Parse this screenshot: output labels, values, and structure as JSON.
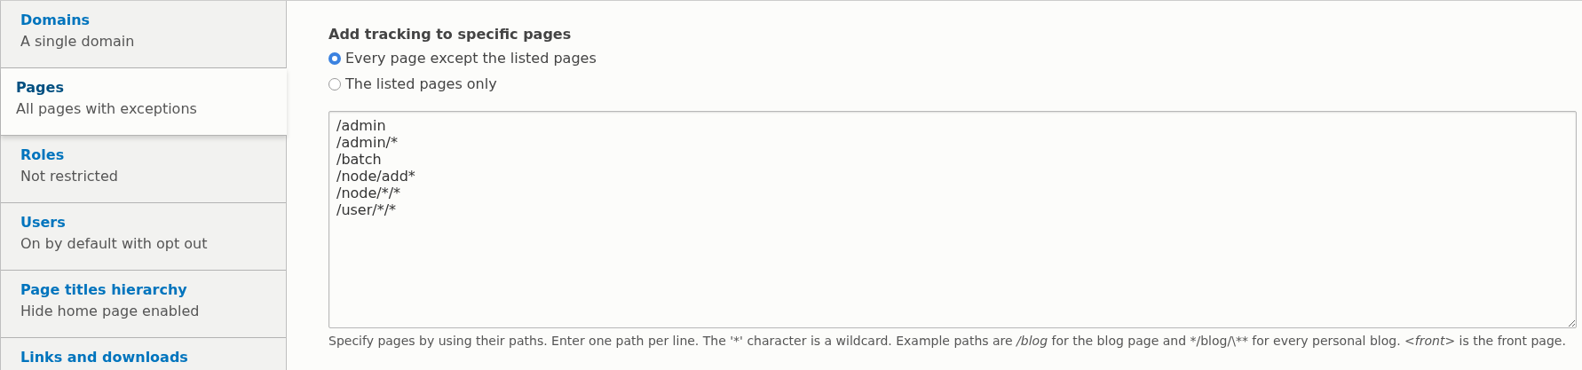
{
  "sidebar": {
    "items": [
      {
        "title": "Domains",
        "summary": "A single domain",
        "selected": false
      },
      {
        "title": "Pages",
        "summary": "All pages with exceptions",
        "selected": true
      },
      {
        "title": "Roles",
        "summary": "Not restricted",
        "selected": false
      },
      {
        "title": "Users",
        "summary": "On by default with opt out",
        "selected": false
      },
      {
        "title": "Page titles hierarchy",
        "summary": "Hide home page enabled",
        "selected": false
      },
      {
        "title": "Links and downloads",
        "selected": false
      }
    ]
  },
  "panel": {
    "heading": "Add tracking to specific pages",
    "radios": [
      {
        "label": "Every page except the listed pages",
        "selected": true
      },
      {
        "label": "The listed pages only",
        "selected": false
      }
    ],
    "pages_field": {
      "value": "/admin\n/admin/*\n/batch\n/node/add*\n/node/*/*\n/user/*/*"
    },
    "description": "Specify pages by using their paths. Enter one path per line. The '*' character is a wildcard. Example paths are */blog* for the blog page and */blog/\\** for every personal blog. *<front>* is the front page."
  }
}
